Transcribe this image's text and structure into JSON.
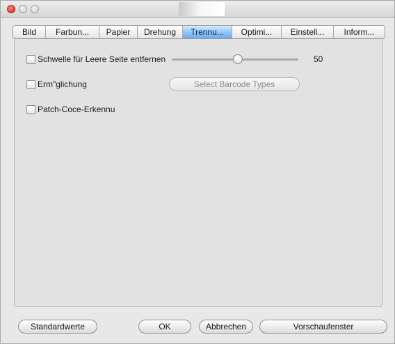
{
  "window": {
    "close_icon": "close-icon",
    "minimize_icon": "minimize-icon",
    "zoom_icon": "zoom-icon"
  },
  "tabs": [
    {
      "label": "Bild",
      "active": false
    },
    {
      "label": "Farbun...",
      "active": false
    },
    {
      "label": "Papier",
      "active": false
    },
    {
      "label": "Drehung",
      "active": false
    },
    {
      "label": "Trennu...",
      "active": true
    },
    {
      "label": "Optimi...",
      "active": false
    },
    {
      "label": "Einstell...",
      "active": false
    },
    {
      "label": "Inform...",
      "active": false
    }
  ],
  "options": {
    "blank_page": {
      "label": "Schwelle für Leere Seite entfernen",
      "checked": false,
      "value": "50",
      "slider_fraction": 0.52
    },
    "barcode": {
      "label": "Erm\"glichung",
      "checked": false,
      "button_label": "Select Barcode Types"
    },
    "patch_code": {
      "label": "Patch-Coce-Erkennu",
      "checked": false
    }
  },
  "footer": {
    "defaults_label": "Standardwerte",
    "ok_label": "OK",
    "cancel_label": "Abbrechen",
    "preview_label": "Vorschaufenster"
  },
  "colors": {
    "active_tab": "#8ec4f6",
    "close_button": "#e0443e"
  }
}
